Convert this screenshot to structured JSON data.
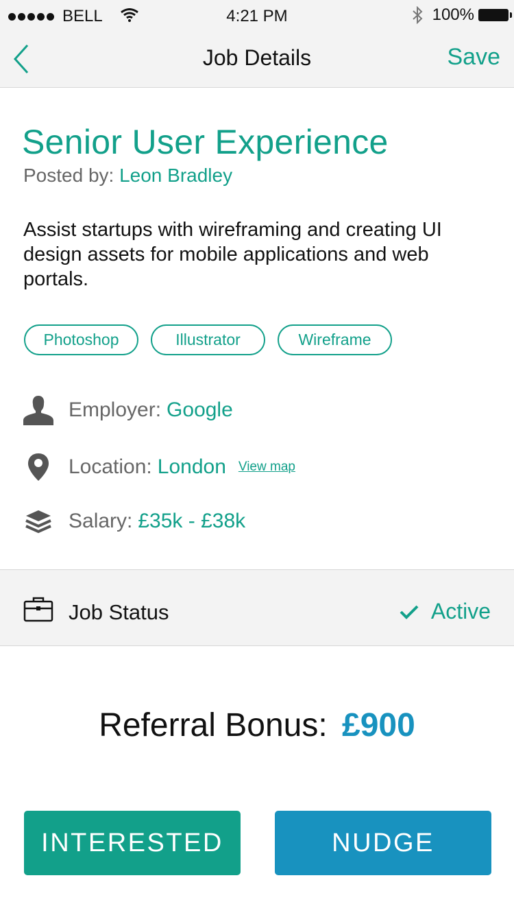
{
  "status_bar": {
    "carrier": "BELL",
    "time": "4:21 PM",
    "battery": "100%",
    "icons": [
      "signal-dots-icon",
      "wifi-icon",
      "bluetooth-icon",
      "battery-icon"
    ]
  },
  "navbar": {
    "title": "Job Details",
    "save_label": "Save",
    "back_icon": "chevron-left-icon"
  },
  "job": {
    "title": "Senior User Experience",
    "posted_label": "Posted by:",
    "posted_by": "Leon Bradley",
    "description": "Assist startups with wireframing and creating UI design assets for mobile applications and web portals.",
    "tags": [
      "Photoshop",
      "Illustrator",
      "Wireframe"
    ],
    "employer_label": "Employer:",
    "employer": "Google",
    "location_label": "Location:",
    "location": "London",
    "view_map": "View map",
    "salary_label": "Salary:",
    "salary": "£35k - £38k"
  },
  "status": {
    "label": "Job Status",
    "value": "Active"
  },
  "referral": {
    "label": "Referral Bonus:",
    "amount": "£900"
  },
  "actions": {
    "interested": "INTERESTED",
    "nudge": "NUDGE"
  },
  "colors": {
    "accent_green": "#12a08a",
    "accent_blue": "#1892bf",
    "bar_bg": "#f3f3f3",
    "muted_text": "#666666"
  }
}
